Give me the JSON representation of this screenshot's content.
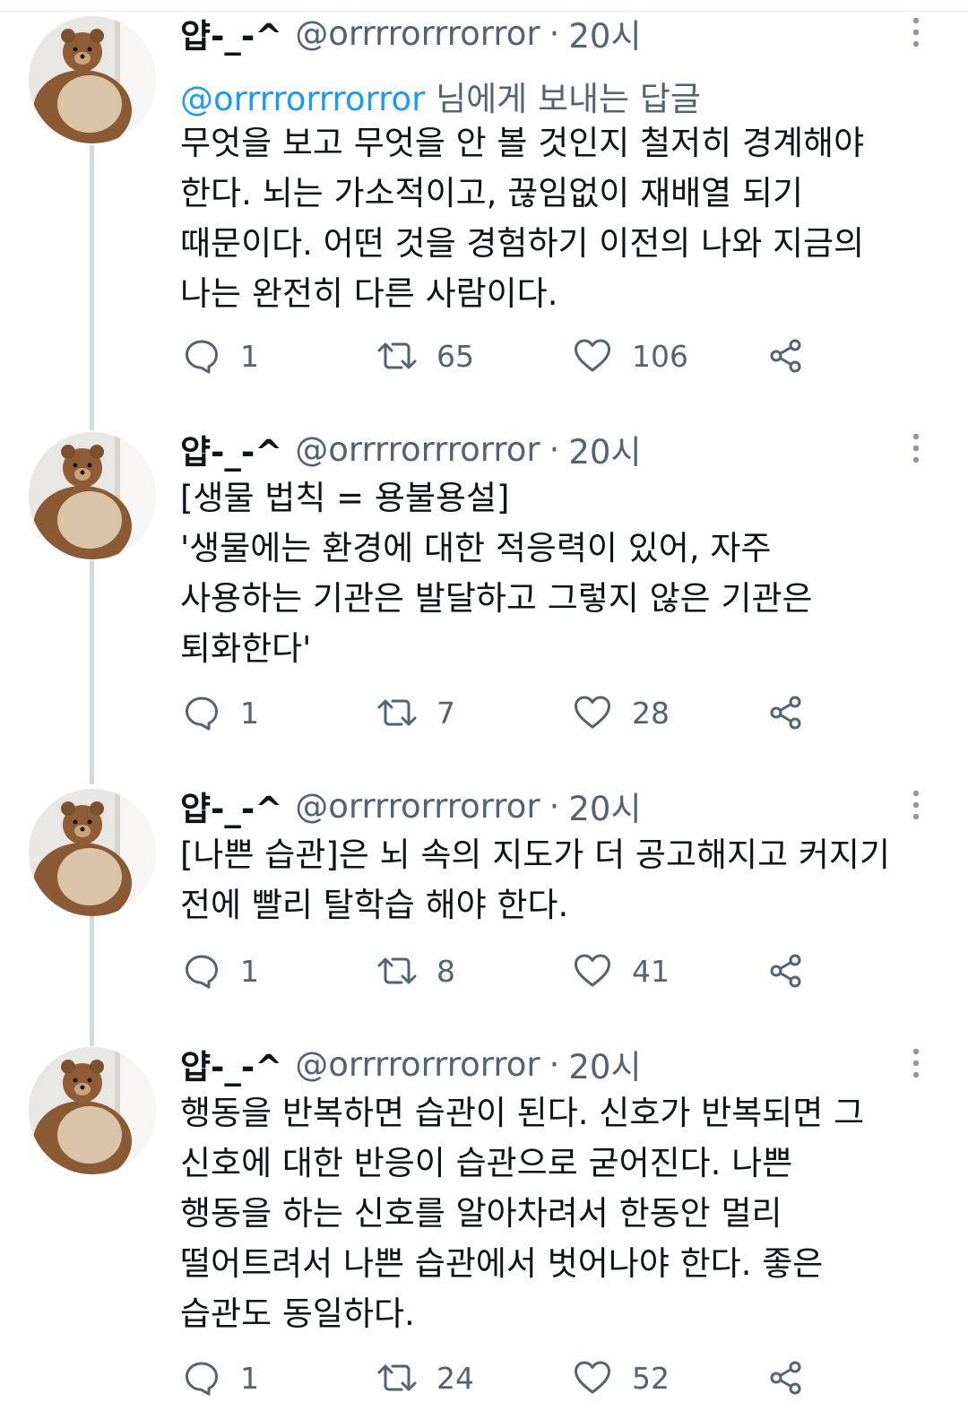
{
  "tweets": [
    {
      "name": "얍-_-^",
      "handle": "@orrrrorrrorror",
      "dot": "·",
      "time": "20시",
      "reply_to": {
        "mention": "@orrrrorrrorror",
        "suffix": " 님에게 보내는 답글"
      },
      "lines": [
        "무엇을 보고 무엇을 안 볼 것인지 철저히 경계해야",
        "한다. 뇌는 가소적이고, 끊임없이 재배열 되기",
        "때문이다. 어떤 것을 경험하기 이전의 나와 지금의",
        "나는 완전히 다른 사람이다."
      ],
      "replies": "1",
      "retweets": "65",
      "likes": "106"
    },
    {
      "name": "얍-_-^",
      "handle": "@orrrrorrrorror",
      "dot": "·",
      "time": "20시",
      "lines": [
        "[생물 법칙 = 용불용설]",
        "'생물에는 환경에 대한 적응력이 있어, 자주",
        "사용하는 기관은 발달하고 그렇지 않은 기관은",
        "퇴화한다'"
      ],
      "replies": "1",
      "retweets": "7",
      "likes": "28"
    },
    {
      "name": "얍-_-^",
      "handle": "@orrrrorrrorror",
      "dot": "·",
      "time": "20시",
      "lines": [
        "[나쁜 습관]은 뇌 속의 지도가 더 공고해지고 커지기",
        "전에 빨리 탈학습 해야 한다."
      ],
      "replies": "1",
      "retweets": "8",
      "likes": "41"
    },
    {
      "name": "얍-_-^",
      "handle": "@orrrrorrrorror",
      "dot": "·",
      "time": "20시",
      "lines": [
        "행동을 반복하면 습관이 된다. 신호가 반복되면 그",
        "신호에 대한 반응이 습관으로 굳어진다. 나쁜",
        "행동을 하는 신호를 알아차려서 한동안 멀리",
        "떨어트려서 나쁜 습관에서 벗어나야 한다. 좋은",
        "습관도 동일하다."
      ],
      "replies": "1",
      "retweets": "24",
      "likes": "52"
    }
  ],
  "icons": {
    "reply": "reply-icon",
    "retweet": "retweet-icon",
    "like": "heart-icon",
    "share": "share-icon",
    "more": "more-vertical-icon",
    "avatar": "teddy-bear-avatar"
  },
  "colors": {
    "text": "#0f1419",
    "secondary": "#536471",
    "link": "#1d9bf0",
    "thread_line": "#cfd9de"
  }
}
